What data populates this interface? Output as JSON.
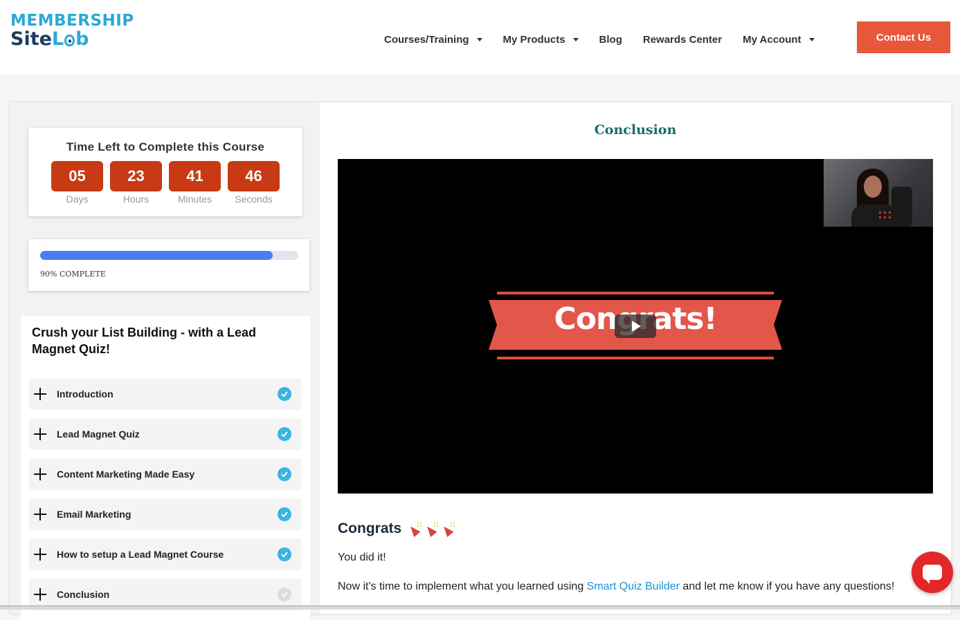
{
  "header": {
    "logo_top": "MEMBERSHIP",
    "logo_site": "Site",
    "logo_lab_l": "L",
    "logo_lab_b": "b",
    "nav": [
      {
        "label": "Courses/Training",
        "dropdown": true
      },
      {
        "label": "My Products",
        "dropdown": true
      },
      {
        "label": "Blog",
        "dropdown": false
      },
      {
        "label": "Rewards Center",
        "dropdown": false
      },
      {
        "label": "My Account",
        "dropdown": true
      }
    ],
    "contact_label": "Contact Us"
  },
  "timer": {
    "title": "Time Left to Complete this Course",
    "units": [
      {
        "value": "05",
        "label": "Days"
      },
      {
        "value": "23",
        "label": "Hours"
      },
      {
        "value": "41",
        "label": "Minutes"
      },
      {
        "value": "46",
        "label": "Seconds"
      }
    ]
  },
  "progress": {
    "percent": 90,
    "label": "90% COMPLETE"
  },
  "course": {
    "title": "Crush your List Building - with a Lead Magnet Quiz!",
    "lessons": [
      {
        "name": "Introduction",
        "complete": true
      },
      {
        "name": "Lead Magnet Quiz",
        "complete": true
      },
      {
        "name": "Content Marketing Made Easy",
        "complete": true
      },
      {
        "name": "Email Marketing",
        "complete": true
      },
      {
        "name": "How to setup a Lead Magnet Course",
        "complete": true
      },
      {
        "name": "Conclusion",
        "complete": false
      }
    ]
  },
  "content": {
    "lesson_heading": "Conclusion",
    "video_banner_text": "Congrats!",
    "congrats_heading": "Congrats",
    "para1": "You did it!",
    "para2_before": "Now it's time to implement what you learned using ",
    "para2_link": "Smart Quiz Builder",
    "para2_after": " and let me know if you have any questions!"
  },
  "colors": {
    "accent": "#e9573a",
    "timer_box": "#c73a13",
    "progress_fill": "#4a7df0",
    "check": "#3bb4e0",
    "heading_teal": "#1c6b73",
    "link": "#1b8fd6",
    "chat": "#e2262a"
  },
  "icons": {
    "lesson_expand": "plus-icon",
    "lesson_done": "check-circle-icon",
    "video_play": "play-icon",
    "chat": "chat-icon",
    "congrats_emoji": "party-popper-icon"
  }
}
